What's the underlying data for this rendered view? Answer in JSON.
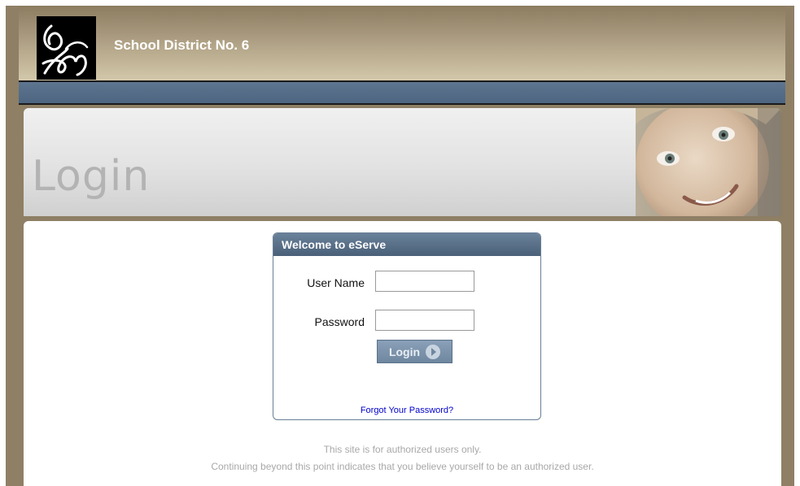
{
  "header": {
    "district_name": "School District No. 6",
    "logo_icon": "district-monogram-logo"
  },
  "banner": {
    "title": "Login",
    "photo_icon": "smiling-child-photo"
  },
  "login_panel": {
    "title": "Welcome to eServe",
    "username_label": "User Name",
    "username_value": "",
    "password_label": "Password",
    "password_value": "",
    "login_label": "Login",
    "login_icon": "play-arrow-icon",
    "forgot_label": "Forgot Your Password?"
  },
  "notice": {
    "line1": "This site is for authorized users only.",
    "line2": "Continuing beyond this point indicates that you believe yourself to be an authorized user."
  },
  "colors": {
    "frame": "#8e7f65",
    "navbar": "#53697f",
    "panel_header": "#5a708a",
    "link": "#0000cc"
  }
}
